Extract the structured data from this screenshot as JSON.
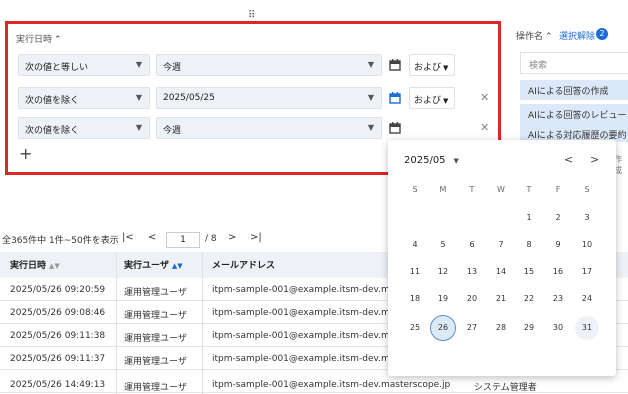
{
  "filter": {
    "title": "実行日時",
    "rows": [
      {
        "operator": "次の値と等しい",
        "value": "今週",
        "conj": "および"
      },
      {
        "operator": "次の値を除く",
        "value": "2025/05/25",
        "conj": "および"
      },
      {
        "operator": "次の値を除く",
        "value": "今週"
      }
    ],
    "add_label": "+"
  },
  "ops": {
    "title": "操作名",
    "clear_label": "選択解除",
    "badge": "2",
    "search_placeholder": "検索",
    "items": [
      "AIによる回答の作成",
      "AIによる回答のレビュー",
      "AIによる対応履歴の要約"
    ],
    "tail_text": "作成"
  },
  "pager": {
    "summary": "全365件中 1件~50件を表示",
    "page": "1",
    "total": "/ 8"
  },
  "table": {
    "columns": [
      "実行日時",
      "実行ユーザ",
      "メールアドレス"
    ],
    "rows": [
      {
        "time": "2025/05/26 09:20:59",
        "user": "運用管理ユーザ",
        "email": "itpm-sample-001@example.itsm-dev.mas",
        "role": ""
      },
      {
        "time": "2025/05/26 09:08:46",
        "user": "運用管理ユーザ",
        "email": "itpm-sample-001@example.itsm-dev.mas",
        "role": ""
      },
      {
        "time": "2025/05/26 09:11:38",
        "user": "運用管理ユーザ",
        "email": "itpm-sample-001@example.itsm-dev.mas",
        "role": ""
      },
      {
        "time": "2025/05/26 09:11:37",
        "user": "運用管理ユーザ",
        "email": "itpm-sample-001@example.itsm-dev.mas",
        "role": ""
      },
      {
        "time": "2025/05/26 14:49:13",
        "user": "運用管理ユーザ",
        "email": "itpm-sample-001@example.itsm-dev.masterscope.jp",
        "role": "システム管理者"
      }
    ]
  },
  "calendar": {
    "month_label": "2025/05",
    "weekdays": [
      "S",
      "M",
      "T",
      "W",
      "T",
      "F",
      "S"
    ],
    "weeks": [
      [
        "",
        "",
        "",
        "",
        "1",
        "2",
        "3"
      ],
      [
        "4",
        "5",
        "6",
        "7",
        "8",
        "9",
        "10"
      ],
      [
        "11",
        "12",
        "13",
        "14",
        "15",
        "16",
        "17"
      ],
      [
        "18",
        "19",
        "20",
        "21",
        "22",
        "23",
        "24"
      ],
      [
        "25",
        "26",
        "27",
        "28",
        "29",
        "30",
        "31"
      ]
    ],
    "selected_day": "26",
    "highlight_day": "31"
  },
  "colors": {
    "highlight_border": "#e02525",
    "accent": "#1a6dd6"
  }
}
